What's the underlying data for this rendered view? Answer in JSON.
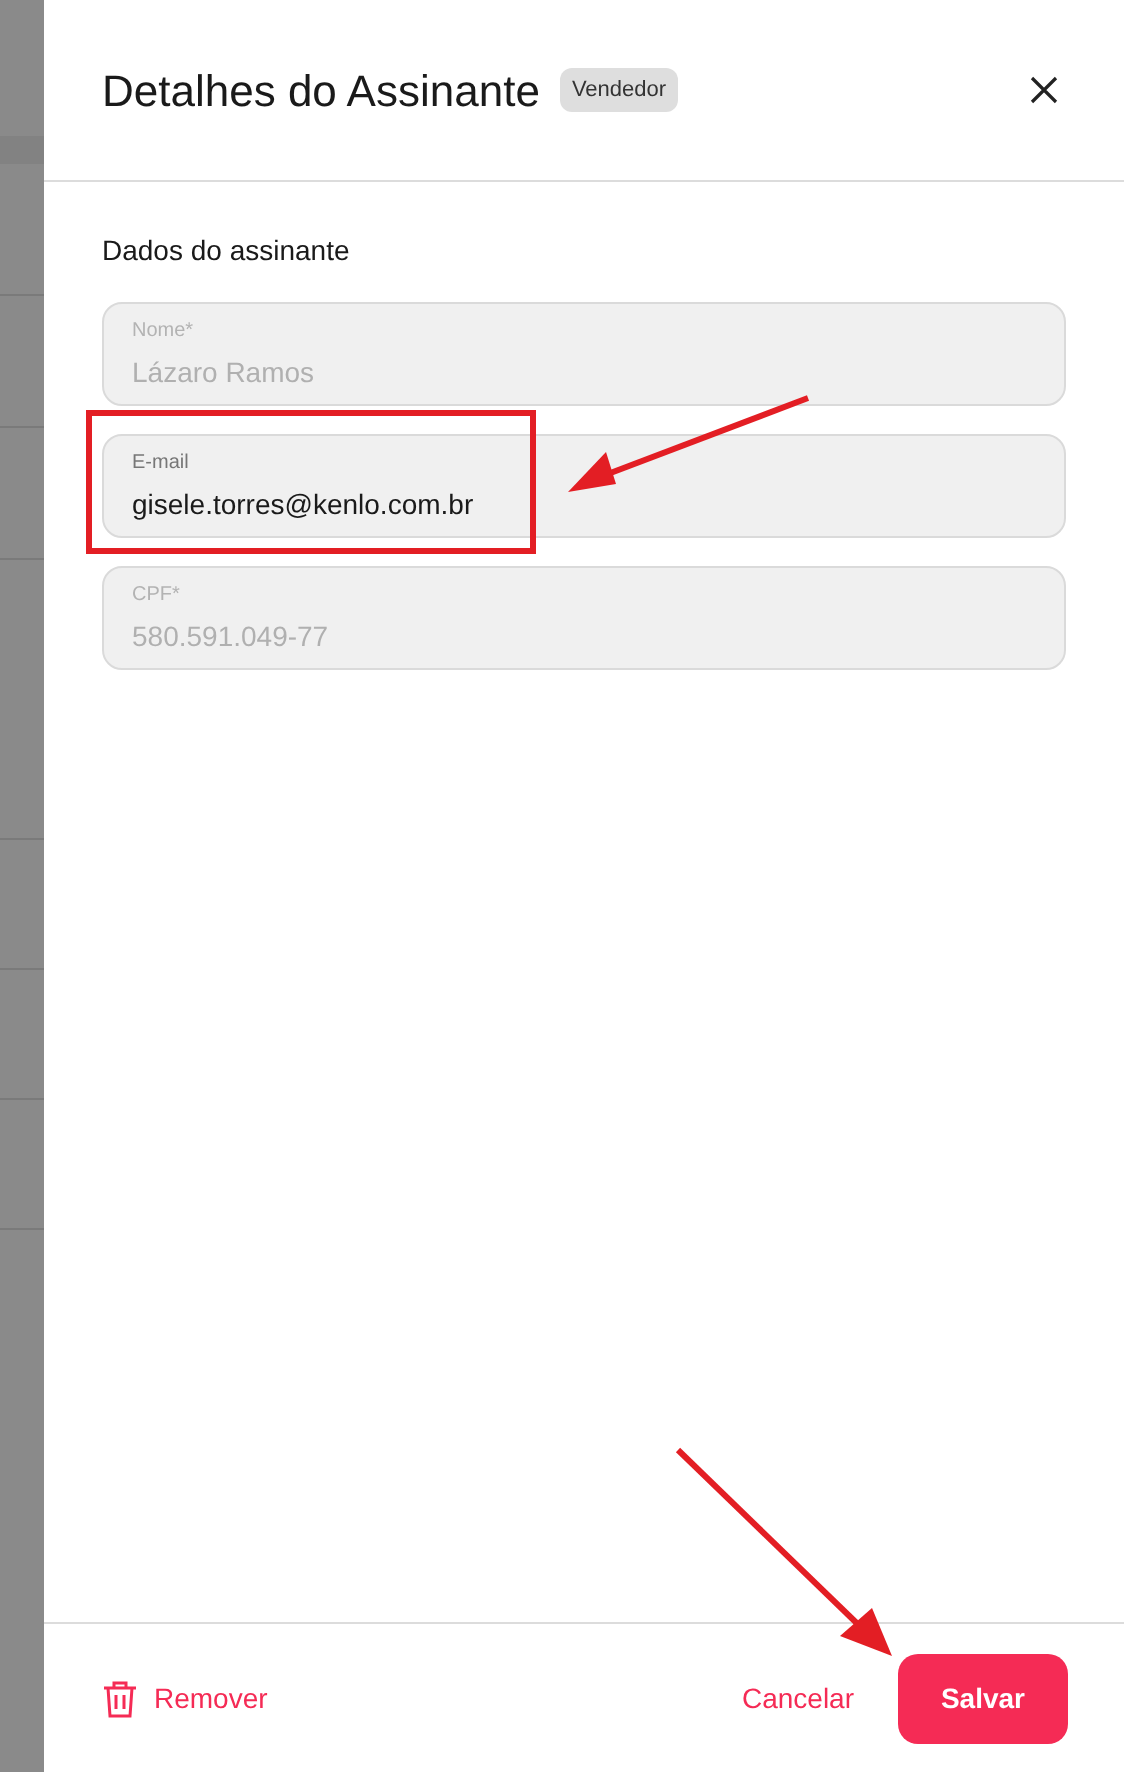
{
  "header": {
    "title": "Detalhes do Assinante",
    "badge": "Vendedor"
  },
  "section": {
    "title": "Dados do assinante"
  },
  "fields": [
    {
      "label": "Nome*",
      "value": "Lázaro Ramos",
      "disabled": true
    },
    {
      "label": "E-mail",
      "value": "gisele.torres@kenlo.com.br",
      "disabled": false
    },
    {
      "label": "CPF*",
      "value": "580.591.049-77",
      "disabled": true
    }
  ],
  "footer": {
    "remove": "Remover",
    "cancel": "Cancelar",
    "save": "Salvar"
  }
}
